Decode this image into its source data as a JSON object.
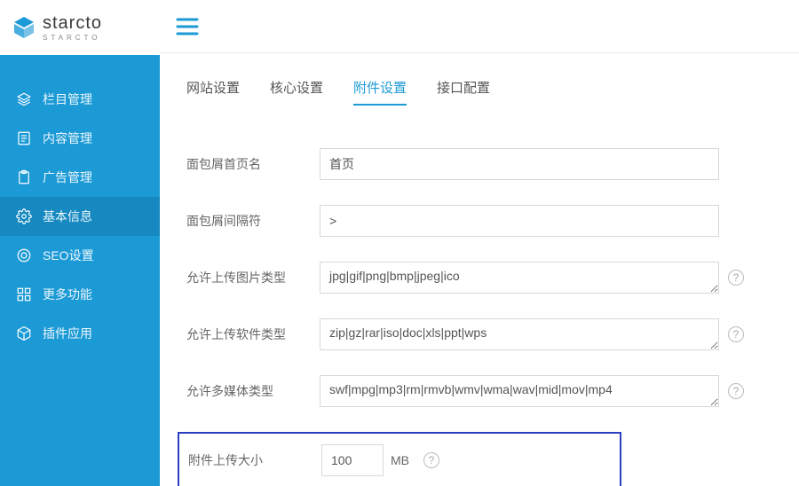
{
  "brand": {
    "name": "starcto",
    "sub": "STARCTO"
  },
  "sidebar": {
    "items": [
      {
        "key": "columns",
        "label": "栏目管理"
      },
      {
        "key": "content",
        "label": "内容管理"
      },
      {
        "key": "ads",
        "label": "广告管理"
      },
      {
        "key": "basic",
        "label": "基本信息",
        "active": true
      },
      {
        "key": "seo",
        "label": "SEO设置"
      },
      {
        "key": "more",
        "label": "更多功能"
      },
      {
        "key": "plugins",
        "label": "插件应用"
      }
    ]
  },
  "tabs": [
    {
      "key": "site",
      "label": "网站设置"
    },
    {
      "key": "core",
      "label": "核心设置"
    },
    {
      "key": "attach",
      "label": "附件设置",
      "active": true
    },
    {
      "key": "api",
      "label": "接口配置"
    }
  ],
  "form": {
    "breadcrumb_home": {
      "label": "面包屑首页名",
      "value": "首页"
    },
    "breadcrumb_sep": {
      "label": "面包屑间隔符",
      "value": ">"
    },
    "image_types": {
      "label": "允许上传图片类型",
      "value": "jpg|gif|png|bmp|jpeg|ico"
    },
    "software_types": {
      "label": "允许上传软件类型",
      "value": "zip|gz|rar|iso|doc|xls|ppt|wps"
    },
    "media_types": {
      "label": "允许多媒体类型",
      "value": "swf|mpg|mp3|rm|rmvb|wmv|wma|wav|mid|mov|mp4"
    },
    "upload_size": {
      "label": "附件上传大小",
      "value": "100",
      "unit": "MB"
    }
  }
}
